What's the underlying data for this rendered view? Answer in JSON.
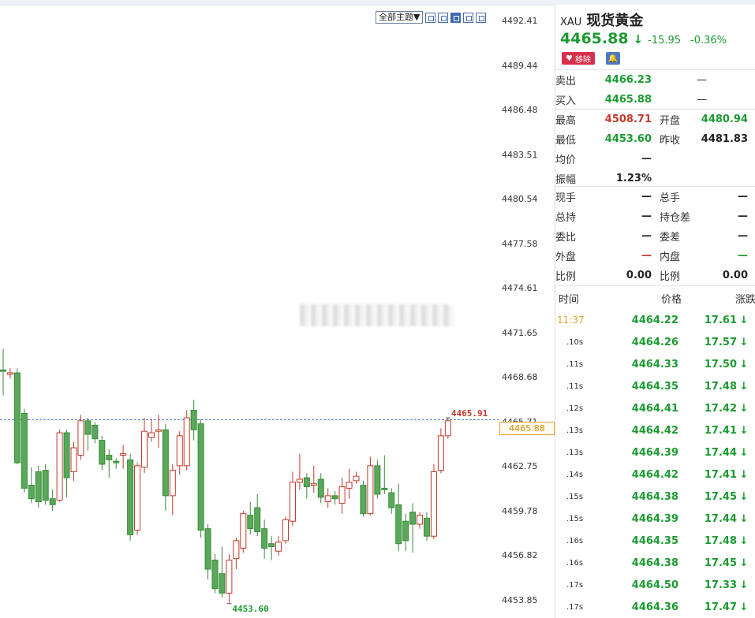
{
  "toolbar": {
    "theme_label": "全部主题▼",
    "buttons": [
      "layout-a-icon",
      "layout-b-icon",
      "layout-c-icon",
      "layout-d-icon",
      "layout-e-icon"
    ]
  },
  "axis": {
    "ticks": [
      "4492.41",
      "4489.44",
      "4486.48",
      "4483.51",
      "4480.54",
      "4477.58",
      "4474.61",
      "4471.65",
      "4468.68",
      "4465.71",
      "4462.75",
      "4459.78",
      "4456.82",
      "4453.85"
    ],
    "current_price_box": "4465.88"
  },
  "chart_data": {
    "type": "candlestick",
    "ylim": [
      4453.85,
      4492.41
    ],
    "annotations": {
      "last_high": "4465.91",
      "low": "4453.60",
      "current_line": 4465.88
    },
    "candles": [
      {
        "o": 4469.2,
        "h": 4470.6,
        "l": 4467.5,
        "c": 4469.1
      },
      {
        "o": 4468.9,
        "h": 4469.3,
        "l": 4468.6,
        "c": 4469.0
      },
      {
        "o": 4469.0,
        "h": 4469.3,
        "l": 4462.9,
        "c": 4463.0
      },
      {
        "o": 4466.3,
        "h": 4466.6,
        "l": 4461.0,
        "c": 4461.3
      },
      {
        "o": 4461.5,
        "h": 4462.7,
        "l": 4460.3,
        "c": 4460.6
      },
      {
        "o": 4462.4,
        "h": 4462.8,
        "l": 4460.0,
        "c": 4460.4
      },
      {
        "o": 4462.5,
        "h": 4462.9,
        "l": 4460.2,
        "c": 4460.5
      },
      {
        "o": 4460.6,
        "h": 4461.2,
        "l": 4459.8,
        "c": 4460.2
      },
      {
        "o": 4460.5,
        "h": 4465.2,
        "l": 4460.4,
        "c": 4465.0
      },
      {
        "o": 4465.0,
        "h": 4465.2,
        "l": 4460.7,
        "c": 4462.0
      },
      {
        "o": 4462.4,
        "h": 4464.4,
        "l": 4461.8,
        "c": 4464.0
      },
      {
        "o": 4463.5,
        "h": 4466.2,
        "l": 4463.2,
        "c": 4465.8
      },
      {
        "o": 4465.8,
        "h": 4466.0,
        "l": 4463.8,
        "c": 4464.9
      },
      {
        "o": 4465.5,
        "h": 4465.7,
        "l": 4464.3,
        "c": 4464.6
      },
      {
        "o": 4464.5,
        "h": 4464.8,
        "l": 4462.5,
        "c": 4462.9
      },
      {
        "o": 4463.5,
        "h": 4463.9,
        "l": 4462.0,
        "c": 4463.2
      },
      {
        "o": 4463.1,
        "h": 4463.3,
        "l": 4462.6,
        "c": 4463.0
      },
      {
        "o": 4463.5,
        "h": 4464.2,
        "l": 4462.6,
        "c": 4463.6
      },
      {
        "o": 4463.2,
        "h": 4463.6,
        "l": 4457.8,
        "c": 4458.2
      },
      {
        "o": 4458.5,
        "h": 4463.0,
        "l": 4458.2,
        "c": 4462.8
      },
      {
        "o": 4462.7,
        "h": 4466.0,
        "l": 4462.3,
        "c": 4465.1
      },
      {
        "o": 4464.7,
        "h": 4465.9,
        "l": 4464.4,
        "c": 4465.0
      },
      {
        "o": 4465.1,
        "h": 4466.2,
        "l": 4464.0,
        "c": 4465.2
      },
      {
        "o": 4465.2,
        "h": 4465.6,
        "l": 4459.8,
        "c": 4460.8
      },
      {
        "o": 4460.8,
        "h": 4462.9,
        "l": 4459.5,
        "c": 4462.5
      },
      {
        "o": 4462.8,
        "h": 4465.1,
        "l": 4462.2,
        "c": 4464.8
      },
      {
        "o": 4462.8,
        "h": 4466.5,
        "l": 4462.5,
        "c": 4466.0
      },
      {
        "o": 4466.5,
        "h": 4467.2,
        "l": 4464.5,
        "c": 4465.2
      },
      {
        "o": 4465.6,
        "h": 4465.9,
        "l": 4458.0,
        "c": 4458.5
      },
      {
        "o": 4458.6,
        "h": 4458.9,
        "l": 4455.2,
        "c": 4455.9
      },
      {
        "o": 4456.5,
        "h": 4456.9,
        "l": 4454.3,
        "c": 4454.6
      },
      {
        "o": 4455.6,
        "h": 4457.4,
        "l": 4454.0,
        "c": 4454.3
      },
      {
        "o": 4454.3,
        "h": 4456.9,
        "l": 4453.6,
        "c": 4456.5
      },
      {
        "o": 4456.6,
        "h": 4458.0,
        "l": 4455.9,
        "c": 4457.8
      },
      {
        "o": 4457.3,
        "h": 4459.8,
        "l": 4457.0,
        "c": 4459.6
      },
      {
        "o": 4459.5,
        "h": 4460.4,
        "l": 4458.2,
        "c": 4458.6
      },
      {
        "o": 4460.0,
        "h": 4460.9,
        "l": 4458.1,
        "c": 4458.4
      },
      {
        "o": 4458.6,
        "h": 4459.2,
        "l": 4456.6,
        "c": 4457.3
      },
      {
        "o": 4457.6,
        "h": 4458.1,
        "l": 4456.5,
        "c": 4457.4
      },
      {
        "o": 4457.1,
        "h": 4458.1,
        "l": 4456.8,
        "c": 4457.7
      },
      {
        "o": 4457.8,
        "h": 4459.4,
        "l": 4457.6,
        "c": 4459.2
      },
      {
        "o": 4459.1,
        "h": 4462.4,
        "l": 4458.8,
        "c": 4461.7
      },
      {
        "o": 4461.7,
        "h": 4463.6,
        "l": 4461.2,
        "c": 4461.9
      },
      {
        "o": 4462.0,
        "h": 4462.3,
        "l": 4460.6,
        "c": 4461.4
      },
      {
        "o": 4461.5,
        "h": 4462.8,
        "l": 4461.0,
        "c": 4461.6
      },
      {
        "o": 4461.9,
        "h": 4462.3,
        "l": 4460.3,
        "c": 4460.7
      },
      {
        "o": 4460.4,
        "h": 4461.3,
        "l": 4460.0,
        "c": 4460.8
      },
      {
        "o": 4460.8,
        "h": 4461.1,
        "l": 4460.2,
        "c": 4460.6
      },
      {
        "o": 4460.3,
        "h": 4462.0,
        "l": 4459.6,
        "c": 4461.4
      },
      {
        "o": 4461.3,
        "h": 4462.6,
        "l": 4460.6,
        "c": 4461.7
      },
      {
        "o": 4461.8,
        "h": 4462.4,
        "l": 4461.6,
        "c": 4462.1
      },
      {
        "o": 4461.5,
        "h": 4461.8,
        "l": 4459.4,
        "c": 4459.6
      },
      {
        "o": 4459.6,
        "h": 4463.4,
        "l": 4459.5,
        "c": 4462.8
      },
      {
        "o": 4462.8,
        "h": 4463.2,
        "l": 4460.6,
        "c": 4460.9
      },
      {
        "o": 4461.3,
        "h": 4463.5,
        "l": 4460.9,
        "c": 4461.2
      },
      {
        "o": 4461.0,
        "h": 4461.3,
        "l": 4459.6,
        "c": 4460.0
      },
      {
        "o": 4460.2,
        "h": 4461.6,
        "l": 4457.1,
        "c": 4457.6
      },
      {
        "o": 4459.1,
        "h": 4459.6,
        "l": 4457.1,
        "c": 4457.8
      },
      {
        "o": 4459.7,
        "h": 4460.3,
        "l": 4457.0,
        "c": 4458.9
      },
      {
        "o": 4458.9,
        "h": 4459.7,
        "l": 4458.6,
        "c": 4459.5
      },
      {
        "o": 4459.3,
        "h": 4459.7,
        "l": 4457.8,
        "c": 4458.1
      },
      {
        "o": 4458.1,
        "h": 4462.9,
        "l": 4457.9,
        "c": 4462.4
      },
      {
        "o": 4462.5,
        "h": 4465.3,
        "l": 4462.3,
        "c": 4464.8
      },
      {
        "o": 4464.8,
        "h": 4466.0,
        "l": 4464.6,
        "c": 4465.8
      }
    ]
  },
  "quote": {
    "symbol": "XAU",
    "name": "现货黄金",
    "price": "4465.88",
    "arrow": "↓",
    "change": "-15.95",
    "change_pct": "-0.36%",
    "remove_label": "移除"
  },
  "bidask": [
    {
      "label": "卖出",
      "value": "4466.23",
      "extra": "—"
    },
    {
      "label": "买入",
      "value": "4465.88",
      "extra": "—"
    }
  ],
  "stats": [
    {
      "l1": "最高",
      "v1": "4508.71",
      "c1": "up",
      "l2": "开盘",
      "v2": "4480.94",
      "c2": "dn"
    },
    {
      "l1": "最低",
      "v1": "4453.60",
      "c1": "dn",
      "l2": "昨收",
      "v2": "4481.83",
      "c2": "neutral"
    },
    {
      "l1": "均价",
      "v1": "—",
      "c1": "neutral",
      "l2": "",
      "v2": "",
      "c2": "neutral"
    },
    {
      "l1": "振幅",
      "v1": "1.23%",
      "c1": "neutral",
      "l2": "",
      "v2": "",
      "c2": "neutral"
    }
  ],
  "stats2": [
    {
      "l1": "现手",
      "v1": "—",
      "c1": "neutral",
      "l2": "总手",
      "v2": "—",
      "c2": "neutral"
    },
    {
      "l1": "总持",
      "v1": "—",
      "c1": "neutral",
      "l2": "持仓差",
      "v2": "—",
      "c2": "neutral"
    },
    {
      "l1": "委比",
      "v1": "—",
      "c1": "neutral",
      "l2": "委差",
      "v2": "—",
      "c2": "neutral"
    },
    {
      "l1": "外盘",
      "v1": "—",
      "c1": "up",
      "l2": "内盘",
      "v2": "—",
      "c2": "dn"
    },
    {
      "l1": "比例",
      "v1": "0.00",
      "c1": "neutral",
      "l2": "比例",
      "v2": "0.00",
      "c2": "neutral"
    }
  ],
  "ticks": {
    "headers": [
      "时间",
      "价格",
      "涨跌"
    ],
    "rows": [
      {
        "time": "11:37",
        "price": "4464.22",
        "change": "17.61",
        "arrow": "↓",
        "highlight": true
      },
      {
        "time": ".10s",
        "price": "4464.26",
        "change": "17.57",
        "arrow": "↓"
      },
      {
        "time": ".11s",
        "price": "4464.33",
        "change": "17.50",
        "arrow": "↓"
      },
      {
        "time": ".11s",
        "price": "4464.35",
        "change": "17.48",
        "arrow": "↓"
      },
      {
        "time": ".12s",
        "price": "4464.41",
        "change": "17.42",
        "arrow": "↓"
      },
      {
        "time": ".13s",
        "price": "4464.42",
        "change": "17.41",
        "arrow": "↓"
      },
      {
        "time": ".13s",
        "price": "4464.39",
        "change": "17.44",
        "arrow": "↓"
      },
      {
        "time": ".14s",
        "price": "4464.42",
        "change": "17.41",
        "arrow": "↓"
      },
      {
        "time": ".15s",
        "price": "4464.38",
        "change": "17.45",
        "arrow": "↓"
      },
      {
        "time": ".15s",
        "price": "4464.39",
        "change": "17.44",
        "arrow": "↓"
      },
      {
        "time": ".16s",
        "price": "4464.35",
        "change": "17.48",
        "arrow": "↓"
      },
      {
        "time": ".16s",
        "price": "4464.38",
        "change": "17.45",
        "arrow": "↓"
      },
      {
        "time": ".17s",
        "price": "4464.50",
        "change": "17.33",
        "arrow": "↓"
      },
      {
        "time": ".17s",
        "price": "4464.36",
        "change": "17.47",
        "arrow": "↓"
      }
    ]
  },
  "colors": {
    "up": "#c0392b",
    "down": "#1c9a32",
    "candle_down_fill": "#5aa85a",
    "current_line": "#3a78c6",
    "accent": "#e08a00"
  }
}
